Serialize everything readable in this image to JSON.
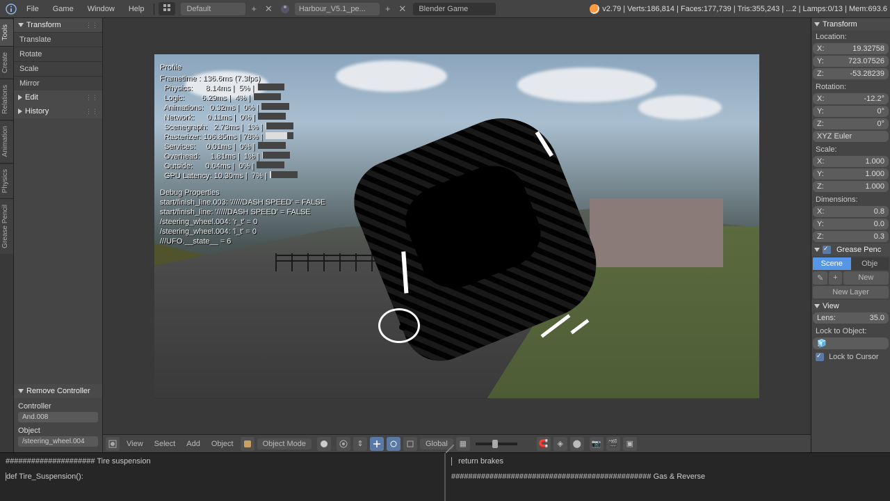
{
  "topbar": {
    "menus": [
      "File",
      "Game",
      "Window",
      "Help"
    ],
    "layout": "Default",
    "scene_name": "Harbour_V5.1_pe...",
    "engine": "Blender Game",
    "stats": "v2.79 | Verts:186,814 | Faces:177,739 | Tris:355,243 | ...2 | Lamps:0/13 | Mem:693.6"
  },
  "vtabs": [
    "Tools",
    "Create",
    "Relations",
    "Animation",
    "Physics",
    "Grease Pencil"
  ],
  "left_panel": {
    "transform_header": "Transform",
    "transform_items": [
      "Translate",
      "Rotate",
      "Scale",
      "Mirror"
    ],
    "edit_header": "Edit",
    "history_header": "History",
    "remove_header": "Remove Controller",
    "controller_lbl": "Controller",
    "controller_val": "And.008",
    "object_lbl": "Object",
    "object_val": "/steering_wheel.004"
  },
  "overlay": {
    "profile_head": "Profile",
    "frametime": "Frametime : 136.6ms (7.3fps)",
    "rows": [
      {
        "name": "Physics:",
        "ms": "8.14ms",
        "pct": "5%",
        "bar": 5
      },
      {
        "name": "Logic:",
        "ms": "6.29ms",
        "pct": "4%",
        "bar": 4
      },
      {
        "name": "Animations:",
        "ms": "0.32ms",
        "pct": "0%",
        "bar": 0
      },
      {
        "name": "Network:",
        "ms": "0.11ms",
        "pct": "0%",
        "bar": 0
      },
      {
        "name": "Scenegraph:",
        "ms": "2.73ms",
        "pct": "1%",
        "bar": 1
      },
      {
        "name": "Rasterizer:",
        "ms": "106.85ms",
        "pct": "78%",
        "bar": 78
      },
      {
        "name": "Services:",
        "ms": "0.01ms",
        "pct": "0%",
        "bar": 0
      },
      {
        "name": "Overhead:",
        "ms": "1.81ms",
        "pct": "1%",
        "bar": 1
      },
      {
        "name": "Outside:",
        "ms": "0.04ms",
        "pct": "0%",
        "bar": 0
      },
      {
        "name": "GPU Latency:",
        "ms": "10.30ms",
        "pct": "7%",
        "bar": 7
      }
    ],
    "debug_head": "Debug Properties",
    "debug_lines": [
      "start/finish_line.003: '/////DASH SPEED' = FALSE",
      "start/finish_line: '/////DASH SPEED' = FALSE",
      "/steering_wheel.004: 'r_t' = 0",
      "/steering_wheel.004: 'l_t' = 0",
      "///UFO.__state__ = 6"
    ]
  },
  "right_panel": {
    "transform_header": "Transform",
    "location_lbl": "Location:",
    "loc_x": "19.32758",
    "loc_y": "723.07526",
    "loc_z": "-53.28239",
    "rotation_lbl": "Rotation:",
    "rot_x": "-12.2°",
    "rot_y": "0°",
    "rot_z": "0°",
    "rot_mode": "XYZ Euler",
    "scale_lbl": "Scale:",
    "sc_x": "1.000",
    "sc_y": "1.000",
    "sc_z": "1.000",
    "dim_lbl": "Dimensions:",
    "dim_x": "0.8",
    "dim_y": "0.0",
    "dim_z": "0.3",
    "gp_header": "Grease Penc",
    "gp_tab_scene": "Scene",
    "gp_tab_obj": "Obje",
    "gp_new": "New",
    "gp_newlayer": "New Layer",
    "view_header": "View",
    "lens_lbl": "Lens:",
    "lens_val": "35.0",
    "lock_obj": "Lock to Object:",
    "lock_cursor": "Lock to Cursor"
  },
  "viewport_header": {
    "menus": [
      "View",
      "Select",
      "Add",
      "Object"
    ],
    "mode": "Object Mode",
    "orientation": "Global"
  },
  "text_editors": {
    "left_line1": "#####################   Tire suspension",
    "left_line2": "def Tire_Suspension():",
    "right_line1": "        return brakes",
    "right_line2": "###############################################   Gas & Reverse"
  }
}
